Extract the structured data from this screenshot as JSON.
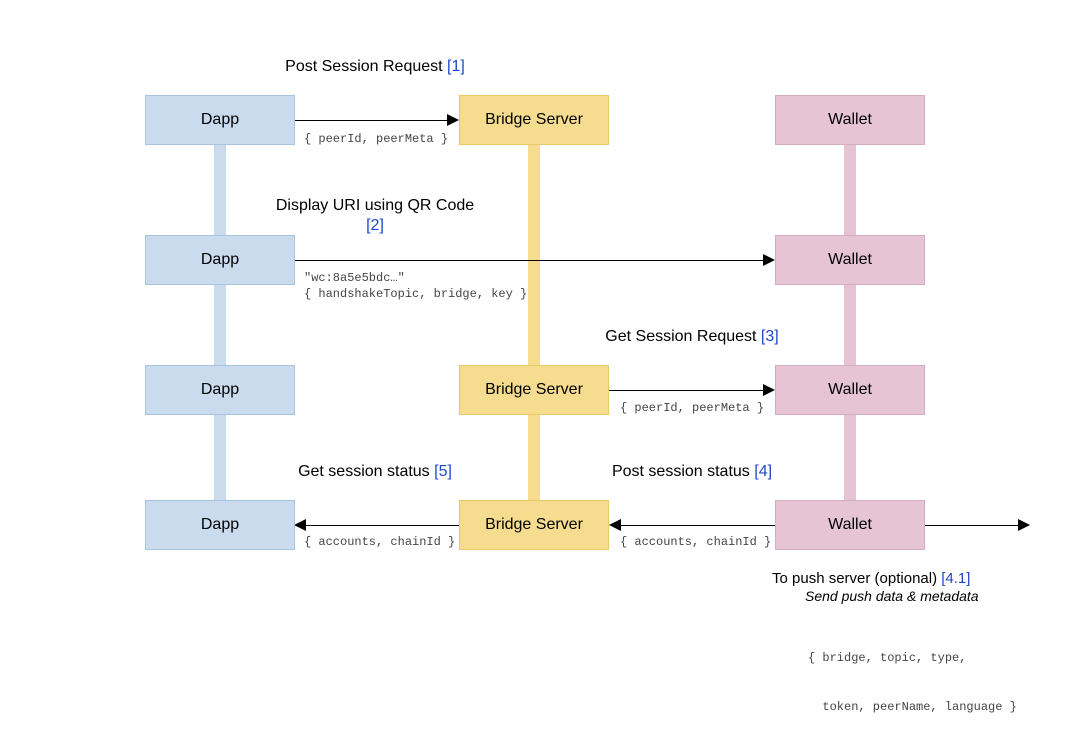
{
  "cols": {
    "dapp": "Dapp",
    "bridge": "Bridge Server",
    "wallet": "Wallet"
  },
  "steps": {
    "s1": {
      "title": "Post Session Request ",
      "num": "[1]",
      "payload": "{ peerId, peerMeta }"
    },
    "s2": {
      "title": "Display URI using QR Code ",
      "num": "[2]",
      "payload1": "\"wc:8a5e5bdc…\"",
      "payload2": "{ handshakeTopic, bridge, key }"
    },
    "s3": {
      "title": "Get Session Request ",
      "num": "[3]",
      "payload": "{ peerId, peerMeta }"
    },
    "s4": {
      "title": "Post session status ",
      "num": "[4]",
      "payload": "{ accounts, chainId }"
    },
    "s5": {
      "title": "Get session status ",
      "num": "[5]",
      "payload": "{ accounts, chainId }"
    },
    "push": {
      "title": "To push server (optional) ",
      "num": "[4.1]",
      "sub": "Send push data & metadata",
      "payload1": "{ bridge, topic, type,",
      "payload2": "  token, peerName, language }"
    }
  },
  "colors": {
    "blue": "#cbdbee",
    "yellow": "#f6dc8f",
    "pink": "#e6c4d4"
  }
}
